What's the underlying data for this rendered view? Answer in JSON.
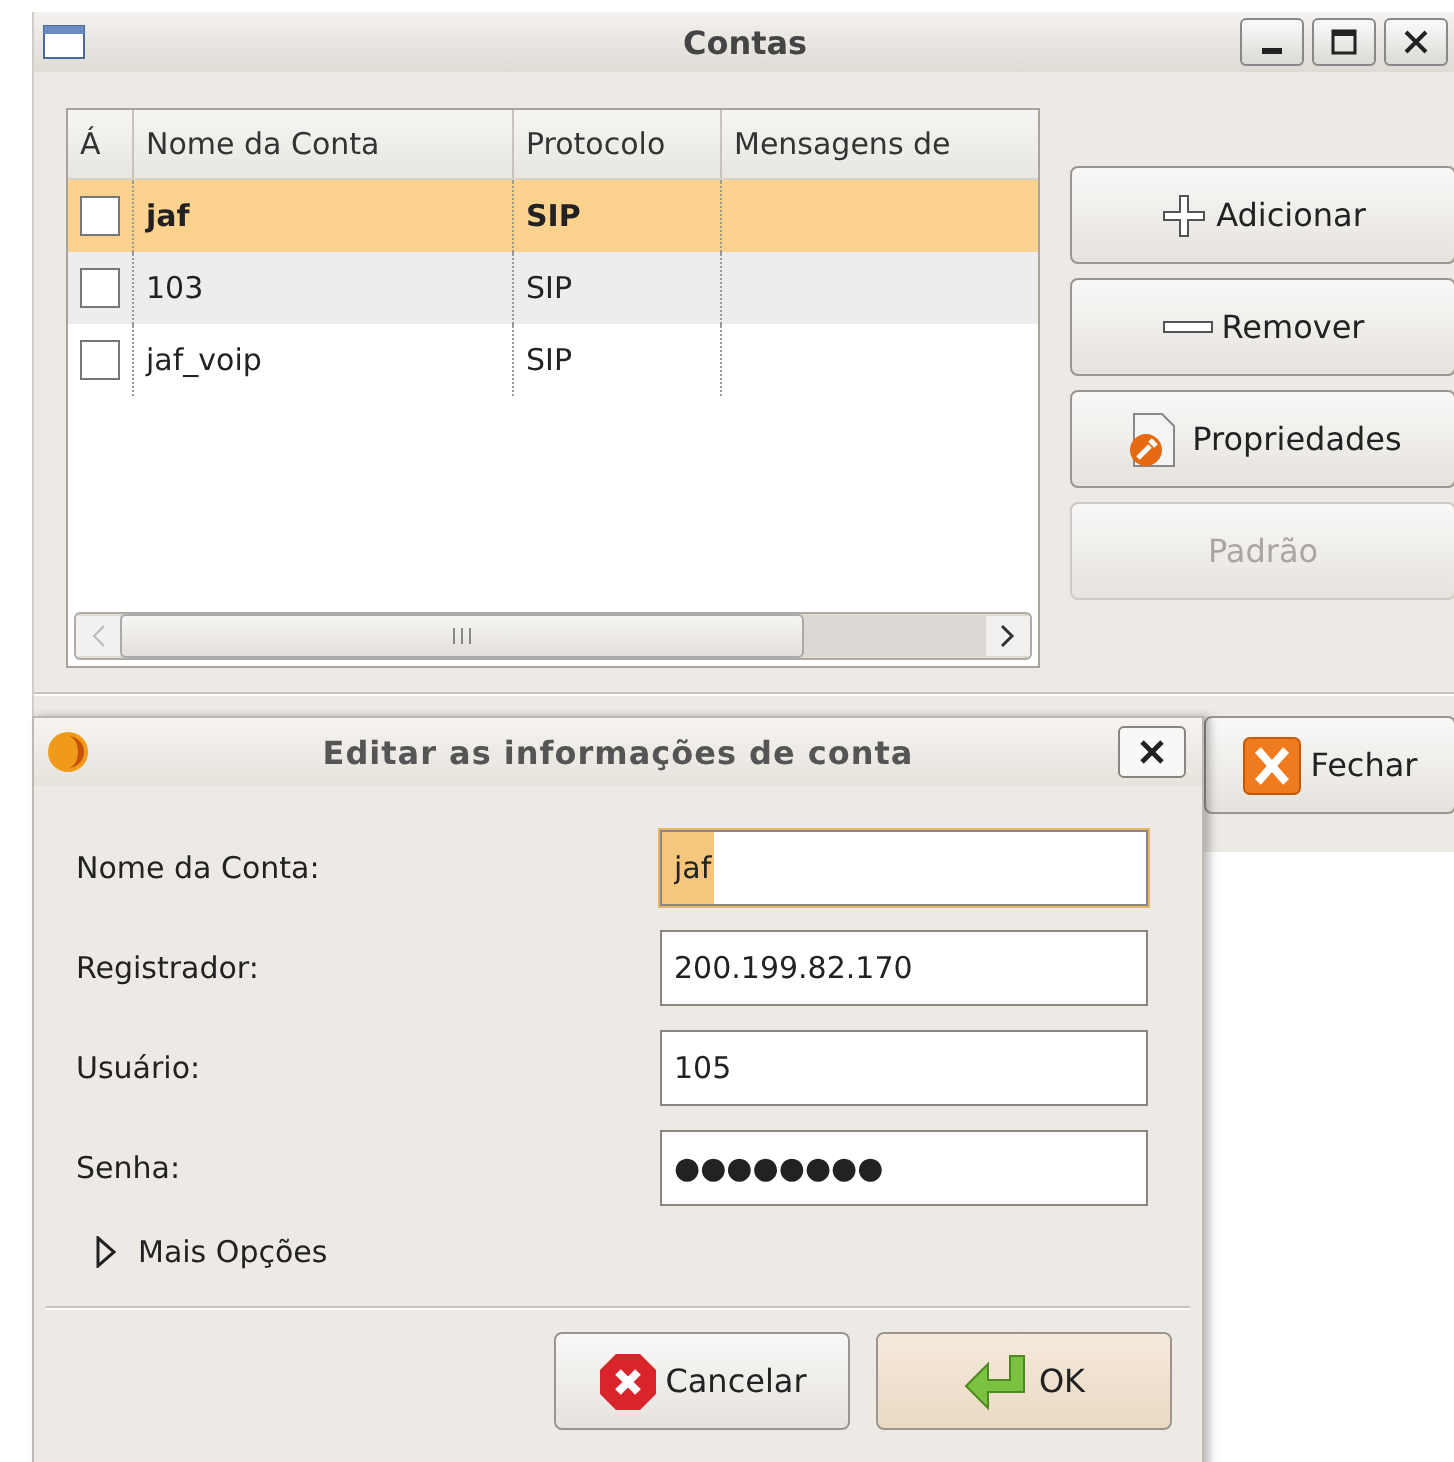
{
  "window": {
    "title": "Contas"
  },
  "table": {
    "columns": [
      "Á",
      "Nome da Conta",
      "Protocolo",
      "Mensagens de"
    ],
    "rows": [
      {
        "checked": false,
        "name": "jaf",
        "protocol": "SIP",
        "selected": true
      },
      {
        "checked": false,
        "name": "103",
        "protocol": "SIP",
        "selected": false
      },
      {
        "checked": false,
        "name": "jaf_voip",
        "protocol": "SIP",
        "selected": false
      }
    ]
  },
  "buttons": [
    {
      "kind": "add",
      "label": "Adicionar",
      "disabled": false
    },
    {
      "kind": "remove",
      "label": "Remover",
      "disabled": false
    },
    {
      "kind": "properties",
      "label": "Propriedades",
      "disabled": false
    },
    {
      "kind": "default",
      "label": "Padrão",
      "disabled": true
    }
  ],
  "close_button": {
    "label": "Fechar"
  },
  "dialog": {
    "title": "Editar as informações de conta",
    "fields": [
      {
        "label": "Nome da Conta:",
        "value": "jaf",
        "focused": true
      },
      {
        "label": "Registrador:",
        "value": "200.199.82.170",
        "focused": false
      },
      {
        "label": "Usuário:",
        "value": "105",
        "focused": false
      },
      {
        "label": "Senha:",
        "value": "●●●●●●●●",
        "focused": false
      }
    ],
    "expander": {
      "label": "Mais Opções",
      "expanded": false
    },
    "buttons": [
      {
        "kind": "cancel",
        "label": "Cancelar",
        "default": false
      },
      {
        "kind": "ok",
        "label": "OK",
        "default": true
      }
    ]
  }
}
